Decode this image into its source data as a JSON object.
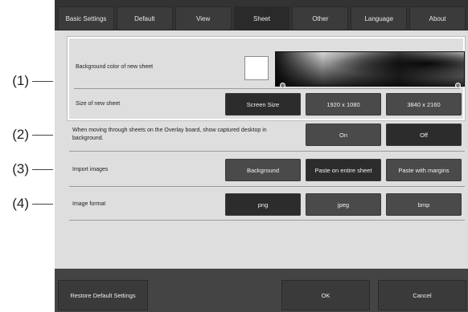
{
  "callouts": [
    "(1)",
    "(2)",
    "(3)",
    "(4)"
  ],
  "tabs": [
    {
      "label": "Basic Settings"
    },
    {
      "label": "Default"
    },
    {
      "label": "View"
    },
    {
      "label": "Sheet",
      "active": true
    },
    {
      "label": "Other"
    },
    {
      "label": "Language"
    },
    {
      "label": "About"
    }
  ],
  "sheet": {
    "bg_color_label": "Background color of new sheet",
    "bg_color_value": "#ffffff",
    "size_label": "Size of new sheet",
    "size_options": [
      "Screen Size",
      "1920 x 1080",
      "3840 x 2160"
    ],
    "size_selected": "Screen Size",
    "overlay_label": "When moving through sheets on the Overlay board, show captured desktop in background.",
    "overlay_options": [
      "On",
      "Off"
    ],
    "overlay_selected": "Off",
    "import_label": "Import images",
    "import_options": [
      "Background",
      "Paste on entire sheet",
      "Paste with margins"
    ],
    "import_selected": "Paste on entire sheet",
    "format_label": "Image format",
    "format_options": [
      "png",
      "jpeg",
      "bmp"
    ],
    "format_selected": "png"
  },
  "footer": {
    "restore_label": "Restore Default Settings",
    "ok_label": "OK",
    "cancel_label": "Cancel"
  }
}
